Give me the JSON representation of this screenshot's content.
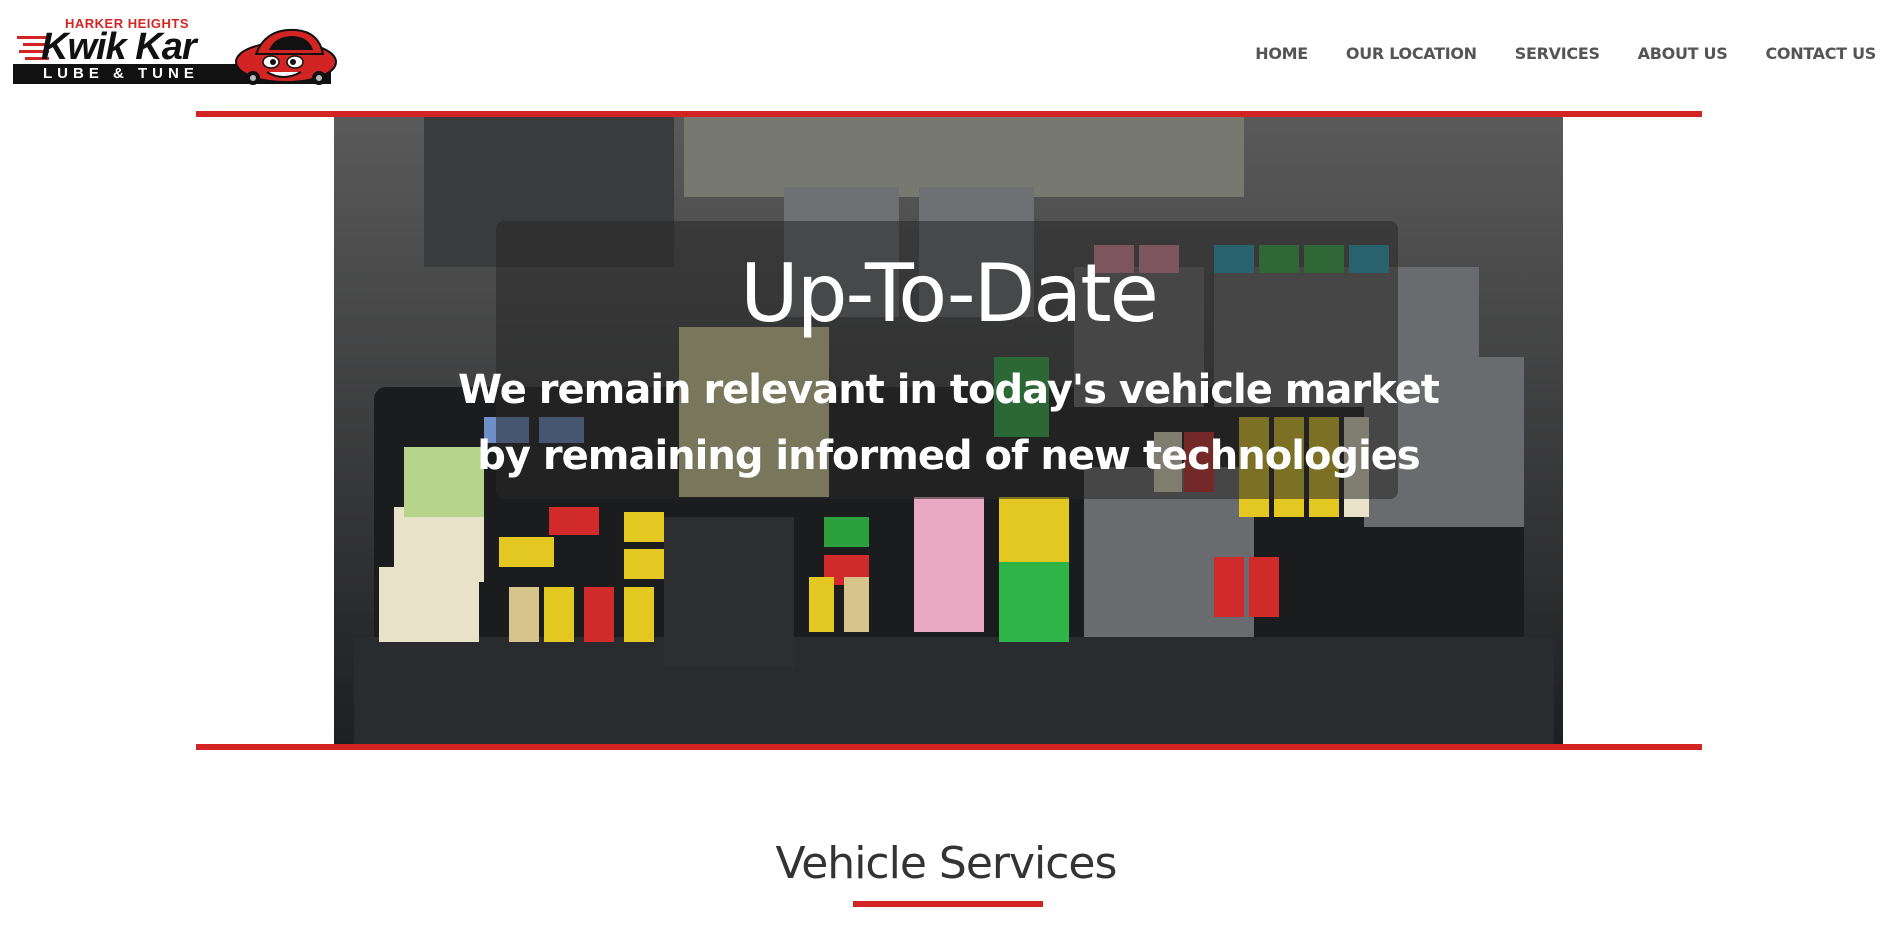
{
  "logo": {
    "top_text": "HARKER HEIGHTS",
    "main_text": "Kwik Kar",
    "bar_text": "LUBE & TUNE"
  },
  "nav": {
    "items": [
      "HOME",
      "OUR LOCATION",
      "SERVICES",
      "ABOUT US",
      "CONTACT US"
    ]
  },
  "hero": {
    "title": "Up-To-Date",
    "subtitle_line1": "We remain relevant in today's vehicle market",
    "subtitle_line2": "by remaining informed of new technologies"
  },
  "section": {
    "title": "Vehicle Services"
  },
  "colors": {
    "accent": "#d32424",
    "nav_text": "#555555",
    "heading": "#333333"
  }
}
